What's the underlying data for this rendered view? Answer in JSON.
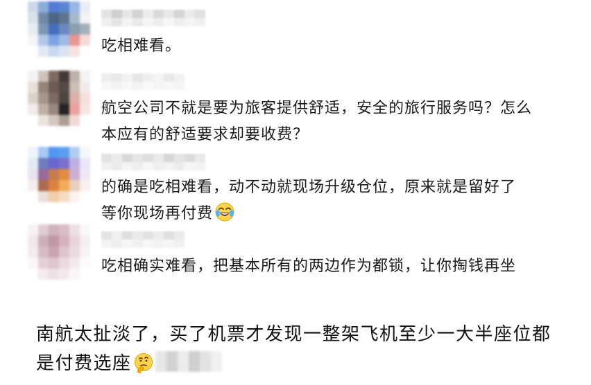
{
  "comments": [
    {
      "text": "吃相难看。"
    },
    {
      "text": "航空公司不就是要为旅客提供舒适，安全的旅行服务吗？怎么本应有的舒适要求却要收费？"
    },
    {
      "text": "的确是吃相难看，动不动就现场升级仓位，原来就是留好了等你现场再付费",
      "emoji": "laughing-crying-emoji"
    },
    {
      "text": "吃相确实难看，把基本所有的两边作为都锁，让你掏钱再坐"
    }
  ],
  "post": {
    "text": "南航太扯淡了，买了机票才发现一整架飞机至少一大半座位都是付费选座",
    "emoji": "thinking-emoji"
  },
  "colors": {
    "text": "#1a1a1a",
    "background": "#ffffff"
  }
}
